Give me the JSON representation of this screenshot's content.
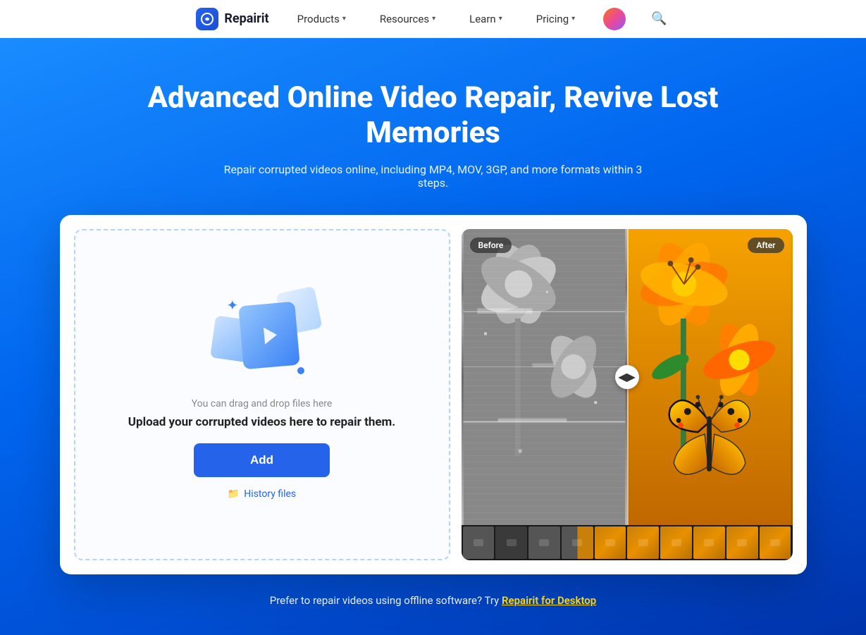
{
  "nav": {
    "logo_text": "Repairit",
    "items": [
      {
        "label": "Products",
        "has_dropdown": true
      },
      {
        "label": "Resources",
        "has_dropdown": true
      },
      {
        "label": "Learn",
        "has_dropdown": true
      },
      {
        "label": "Pricing",
        "has_dropdown": true
      }
    ]
  },
  "hero": {
    "title": "Advanced Online Video Repair, Revive Lost Memories",
    "subtitle": "Repair corrupted videos online, including MP4, MOV, 3GP, and more formats within 3 steps."
  },
  "upload": {
    "drag_text": "You can drag and drop files here",
    "main_text": "Upload your corrupted videos here to repair them.",
    "add_button": "Add",
    "history_label": "History files"
  },
  "preview": {
    "before_label": "Before",
    "after_label": "After"
  },
  "footer": {
    "text": "Prefer to repair videos using offline software? Try ",
    "link_text": "Repairit for Desktop"
  }
}
